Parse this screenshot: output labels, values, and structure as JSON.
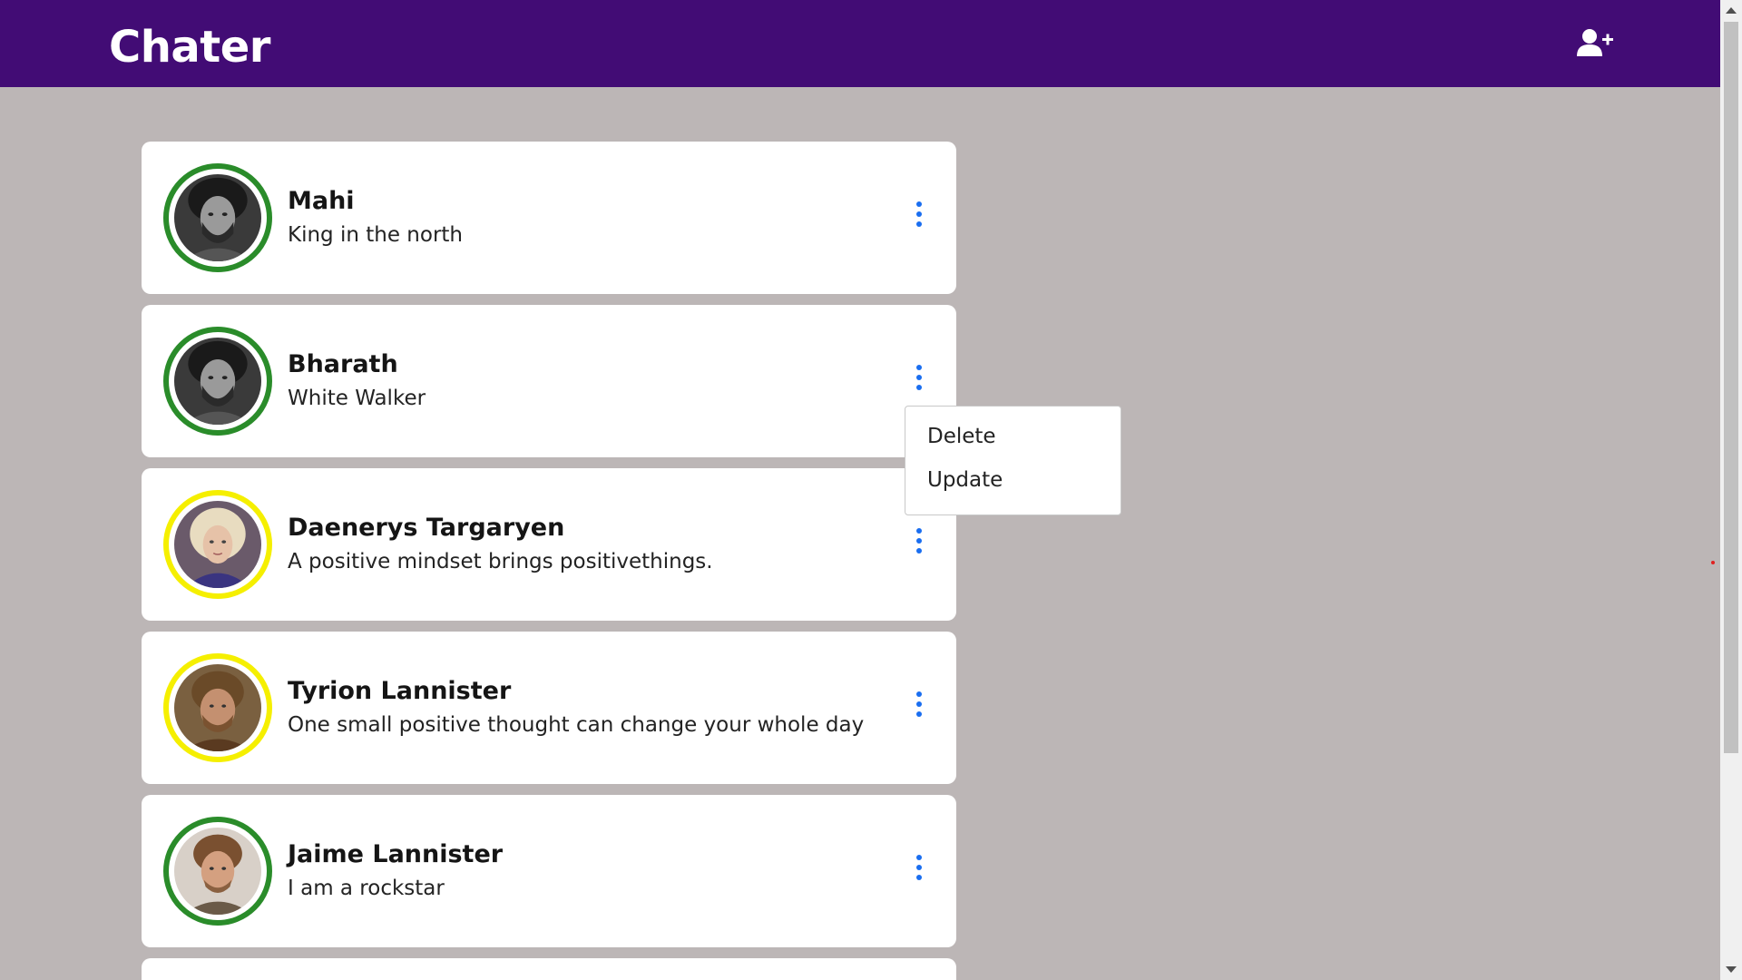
{
  "header": {
    "brand": "Chater",
    "add_user_icon": "user-plus-icon",
    "background": "#420c75"
  },
  "contacts": [
    {
      "name": "Mahi",
      "status": "King in the north",
      "ring_color": "green",
      "avatar_icon": "avatar-jon-icon"
    },
    {
      "name": "Bharath",
      "status": "White Walker",
      "ring_color": "green",
      "avatar_icon": "avatar-jon-icon"
    },
    {
      "name": "Daenerys Targaryen",
      "status": "A positive mindset brings positivethings.",
      "ring_color": "yellow",
      "avatar_icon": "avatar-daenerys-icon"
    },
    {
      "name": "Tyrion Lannister",
      "status": "One small positive thought can change your whole day",
      "ring_color": "yellow",
      "avatar_icon": "avatar-tyrion-icon"
    },
    {
      "name": "Jaime Lannister",
      "status": "I am a rockstar",
      "ring_color": "green",
      "avatar_icon": "avatar-jaime-icon"
    }
  ],
  "menu": {
    "items": [
      "Delete",
      "Update"
    ]
  },
  "colors": {
    "accent": "#1a6ef0",
    "ring_green": "#2a8c2a",
    "ring_yellow": "#f5ef00",
    "page_bg": "#bcb6b6"
  }
}
